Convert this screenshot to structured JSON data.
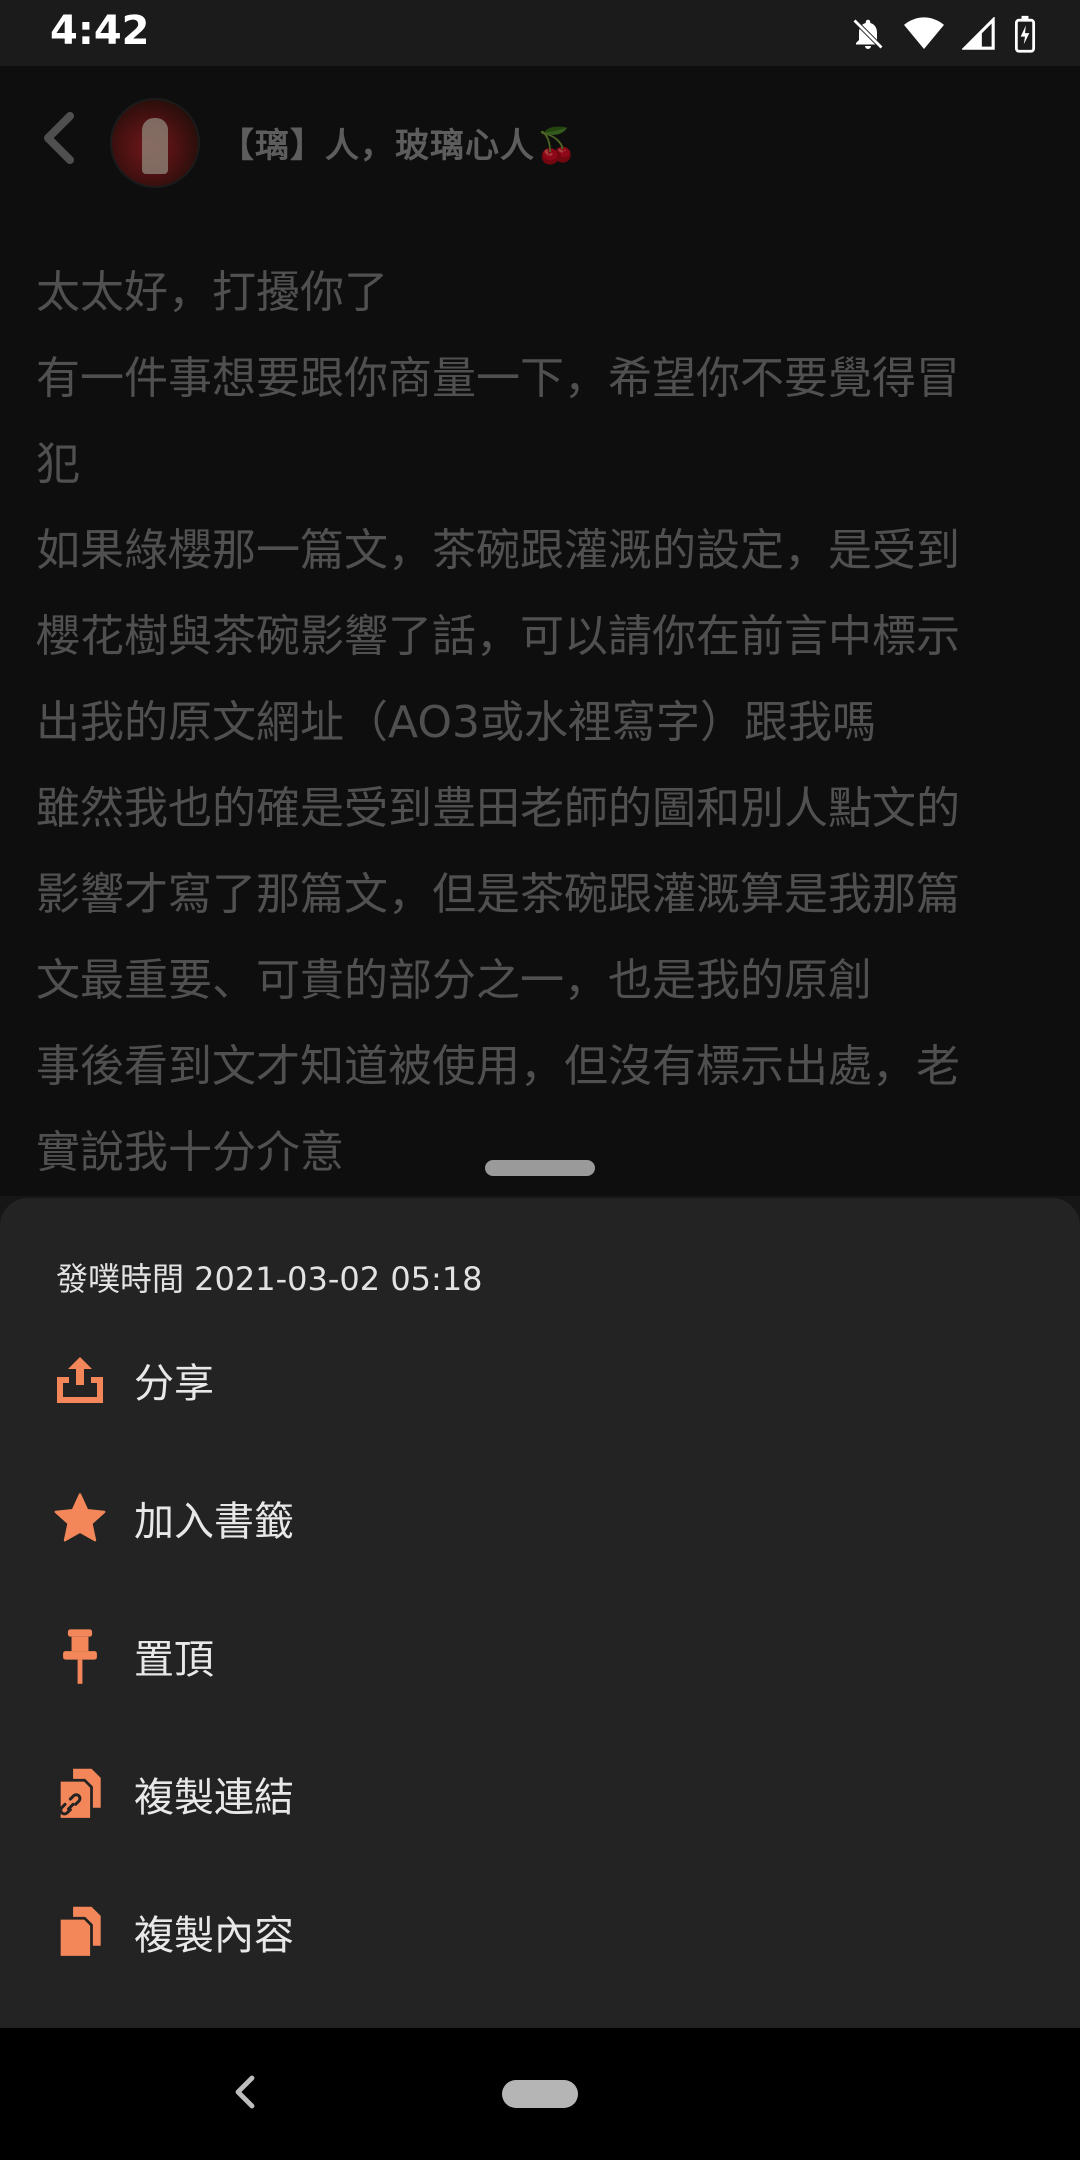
{
  "status_bar": {
    "time": "4:42",
    "icons": [
      "notifications-off-icon",
      "wifi-icon",
      "signal-icon",
      "battery-icon"
    ]
  },
  "header": {
    "user_name": "【璃】人，玻璃心人🍒",
    "back_icon": "chevron-left-icon"
  },
  "post": {
    "lines": [
      "太太好，打擾你了",
      "有一件事想要跟你商量一下，希望你不要覺得冒",
      "犯",
      "如果綠櫻那一篇文，茶碗跟灌溉的設定，是受到",
      "櫻花樹與茶碗影響了話，可以請你在前言中標示",
      "出我的原文網址（AO3或水裡寫字）跟我嗎",
      "雖然我也的確是受到豊田老師的圖和別人點文的",
      "影響才寫了那篇文，但是茶碗跟灌溉算是我那篇",
      "文最重要、可貴的部分之一，也是我的原創",
      "事後看到文才知道被使用，但沒有標示出處，老",
      "實說我十分介意"
    ]
  },
  "sheet": {
    "meta": "發噗時間 2021-03-02 05:18",
    "items": [
      {
        "label": "分享",
        "icon": "share-icon"
      },
      {
        "label": "加入書籤",
        "icon": "star-icon"
      },
      {
        "label": "置頂",
        "icon": "pin-icon"
      },
      {
        "label": "複製連結",
        "icon": "copy-link-icon"
      },
      {
        "label": "複製內容",
        "icon": "copy-content-icon"
      }
    ],
    "accent_color": "#f4875a"
  },
  "nav_bar": {
    "back_icon": "nav-back-icon",
    "home_icon": "home-pill-icon"
  }
}
